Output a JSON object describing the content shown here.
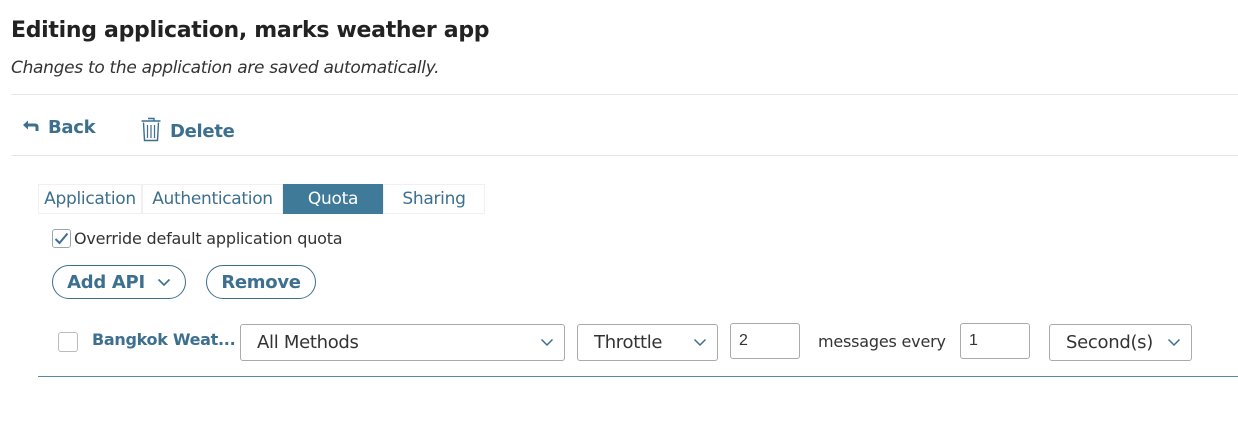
{
  "header": {
    "title": "Editing application, marks weather app",
    "subtitle": "Changes to the application are saved automatically."
  },
  "actions": {
    "back_label": "Back",
    "delete_label": "Delete"
  },
  "tabs": [
    {
      "label": "Application",
      "active": false
    },
    {
      "label": "Authentication",
      "active": false
    },
    {
      "label": "Quota",
      "active": true
    },
    {
      "label": "Sharing",
      "active": false
    }
  ],
  "quota": {
    "override_label": "Override default application quota",
    "override_checked": true,
    "add_api_label": "Add API",
    "remove_label": "Remove",
    "rows": [
      {
        "checked": false,
        "api_name": "Bangkok Weat...",
        "methods": "All Methods",
        "type": "Throttle",
        "count": "2",
        "messages_text": "messages every",
        "interval": "1",
        "unit": "Second(s)"
      }
    ]
  },
  "colors": {
    "accent": "#3d6f8f",
    "active_tab": "#3f7a99"
  }
}
